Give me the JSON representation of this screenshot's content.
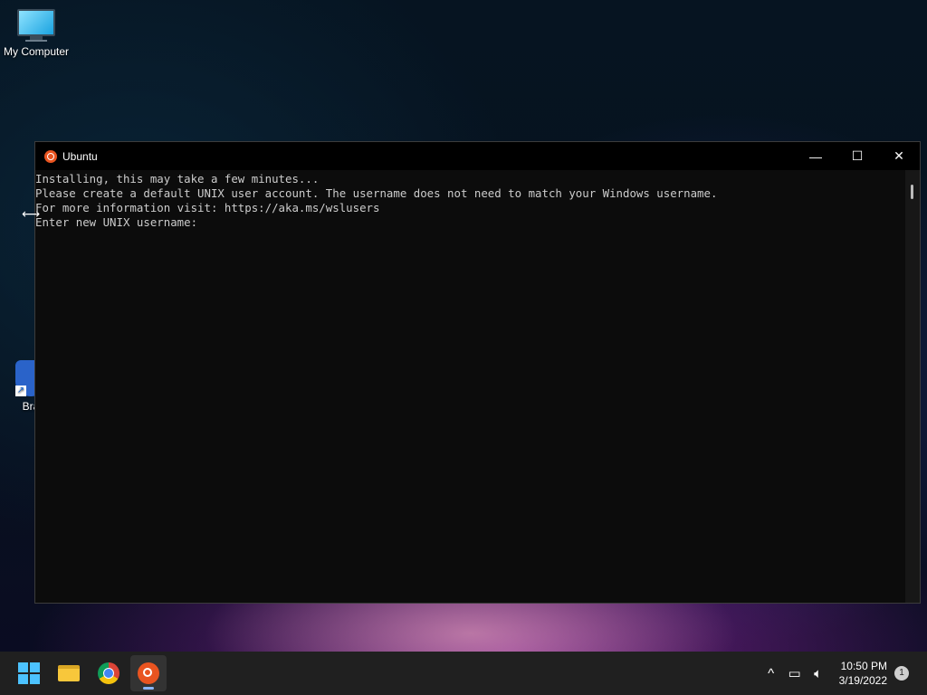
{
  "desktop": {
    "icons": [
      {
        "label": "My Computer"
      },
      {
        "label": "Bra"
      }
    ]
  },
  "window": {
    "title": "Ubuntu",
    "controls": {
      "minimize": "—",
      "maximize": "☐",
      "close": "✕"
    },
    "lines": [
      "Installing, this may take a few minutes...",
      "Please create a default UNIX user account. The username does not need to match your Windows username.",
      "For more information visit: https://aka.ms/wslusers",
      "Enter new UNIX username:"
    ]
  },
  "taskbar": {
    "apps": [
      {
        "icon": "windows-start-icon"
      },
      {
        "icon": "file-explorer-icon"
      },
      {
        "icon": "chrome-icon"
      },
      {
        "icon": "ubuntu-icon",
        "active": true
      }
    ],
    "tray": {
      "chevron": "^",
      "clock_time": "10:50 PM",
      "clock_date": "3/19/2022",
      "notification_count": "1"
    }
  }
}
